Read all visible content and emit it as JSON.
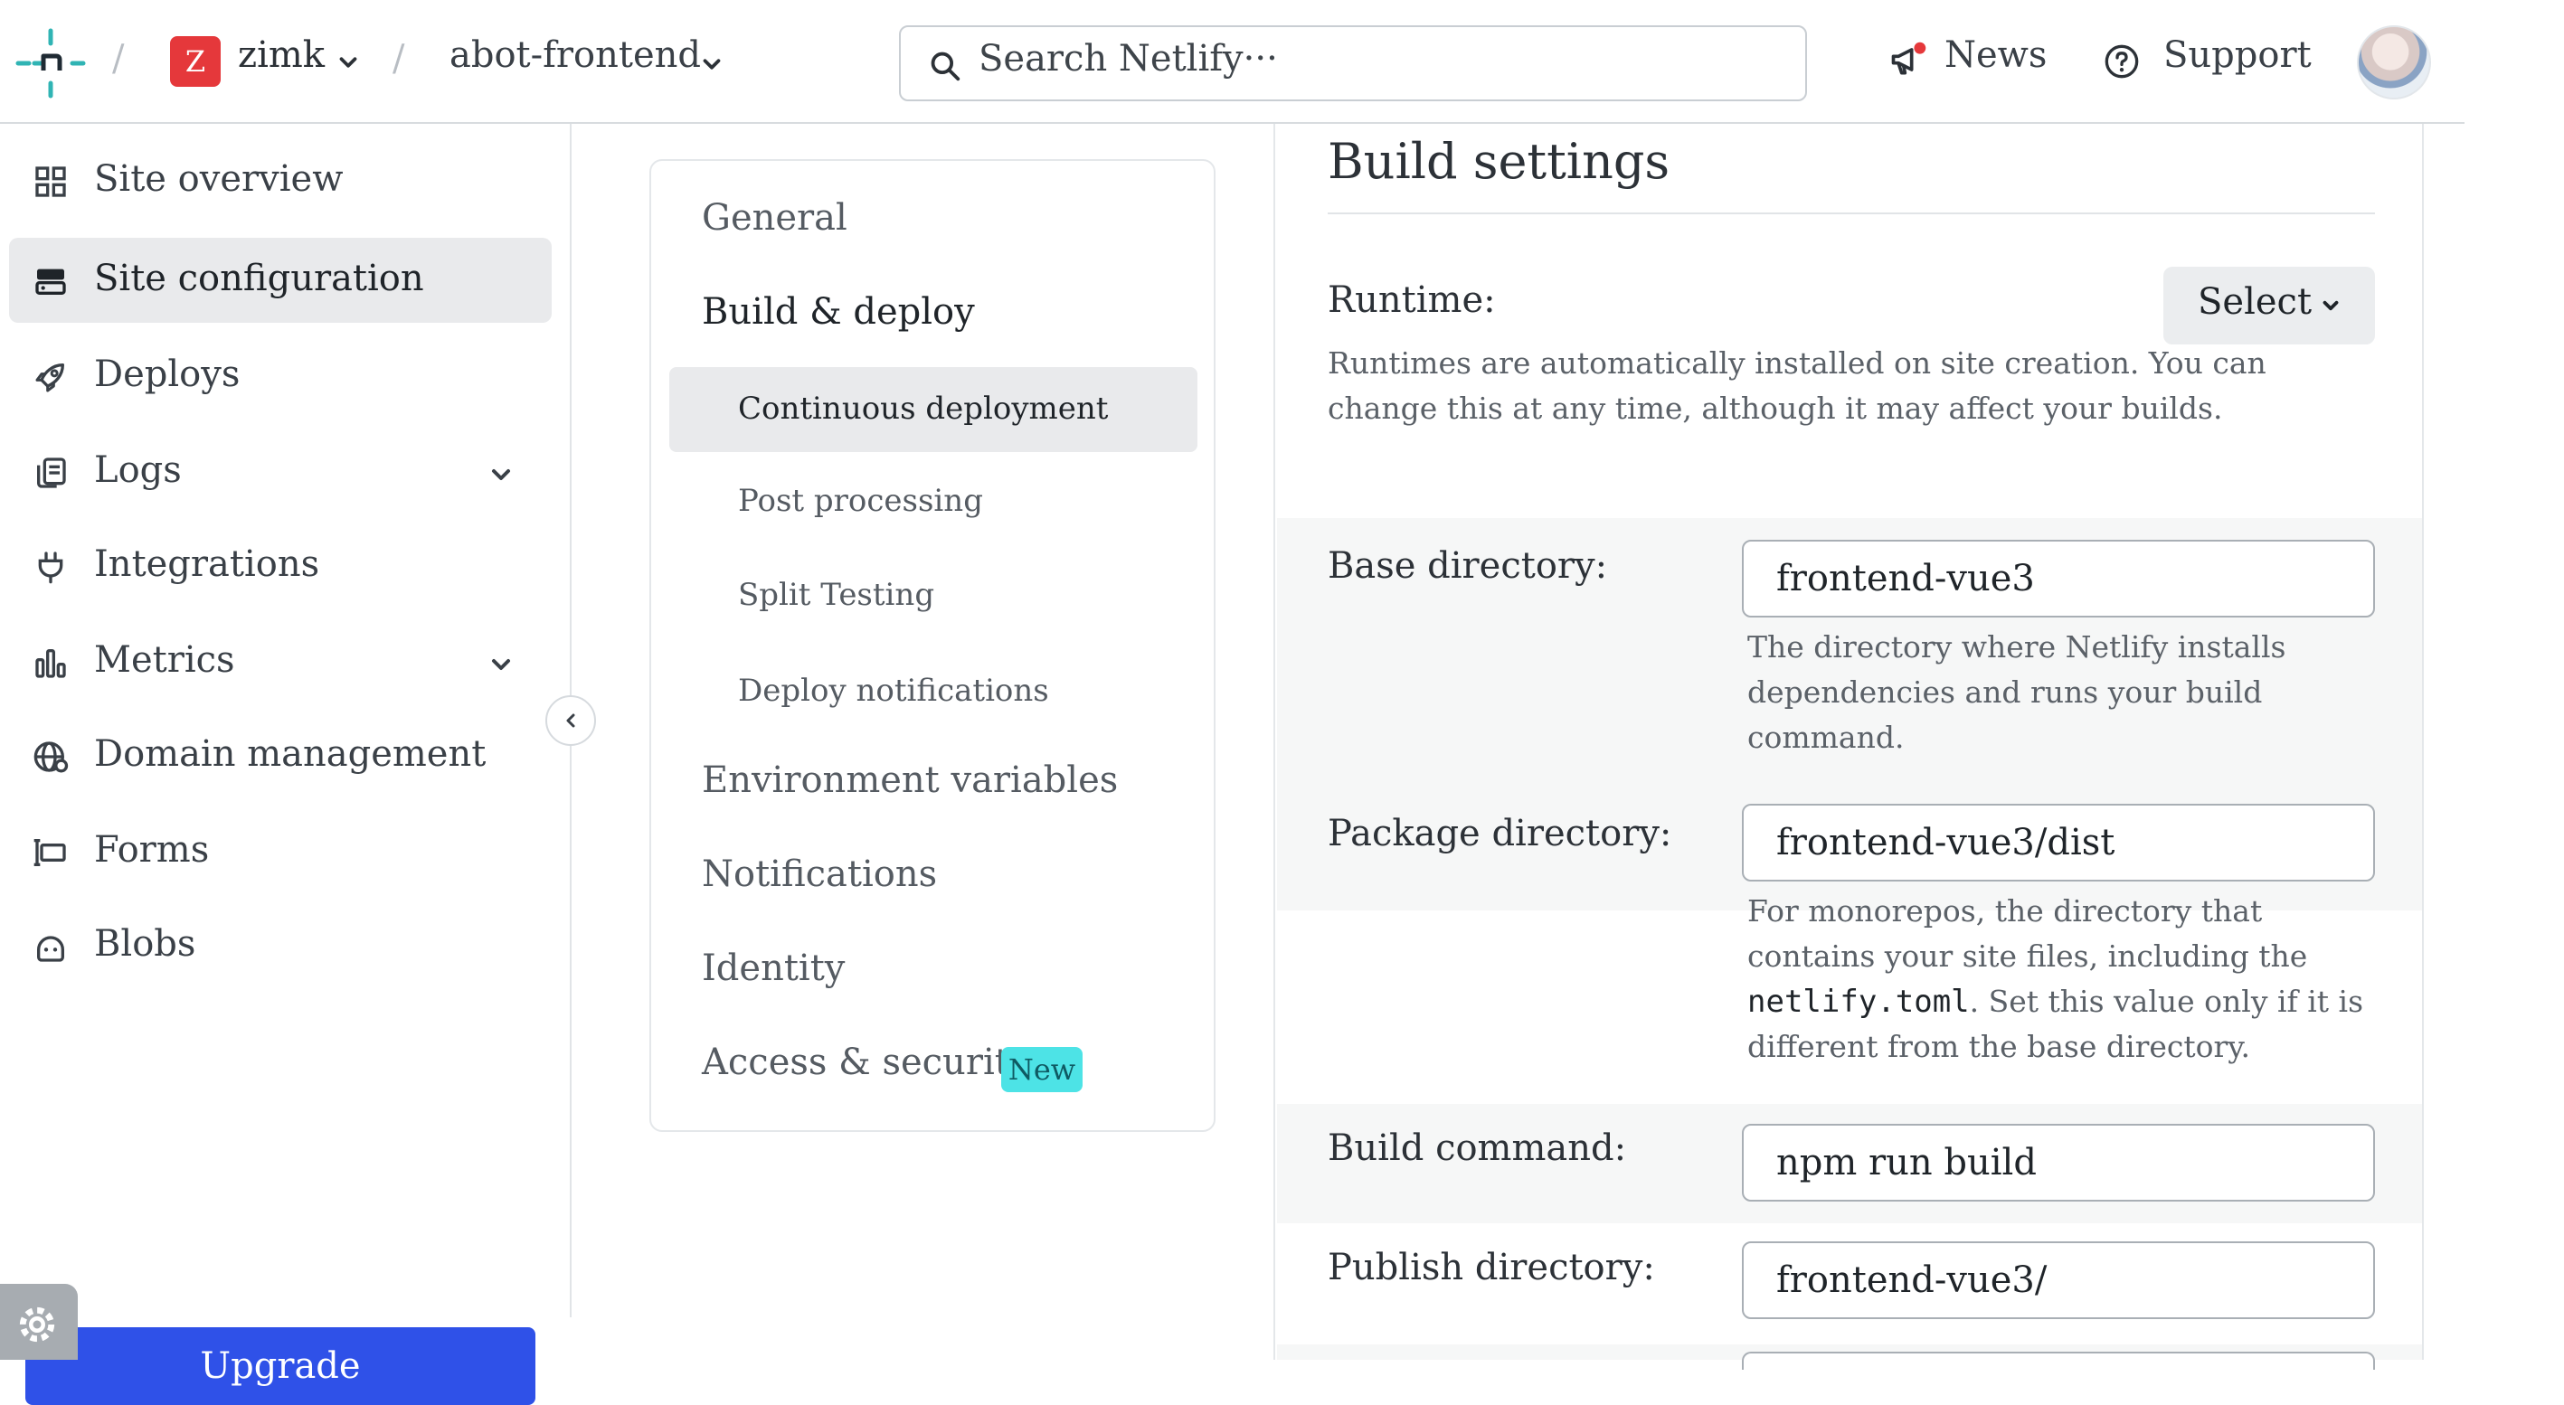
{
  "topbar": {
    "team_initial": "Z",
    "team_name": "zimk",
    "site_name": "abot-frontend",
    "search_placeholder": "Search Netlify···",
    "news_label": "News",
    "support_label": "Support"
  },
  "sidebar": {
    "items": [
      {
        "label": "Site overview",
        "icon": "grid-icon"
      },
      {
        "label": "Site configuration",
        "icon": "server-icon"
      },
      {
        "label": "Deploys",
        "icon": "rocket-icon"
      },
      {
        "label": "Logs",
        "icon": "logs-icon"
      },
      {
        "label": "Integrations",
        "icon": "plug-icon"
      },
      {
        "label": "Metrics",
        "icon": "bar-chart-icon"
      },
      {
        "label": "Domain management",
        "icon": "globe-icon"
      },
      {
        "label": "Forms",
        "icon": "form-icon"
      },
      {
        "label": "Blobs",
        "icon": "blob-icon"
      }
    ],
    "upgrade_label": "Upgrade"
  },
  "subnav": {
    "general": "General",
    "build_deploy": "Build & deploy",
    "children": [
      "Continuous deployment",
      "Post processing",
      "Split Testing",
      "Deploy notifications"
    ],
    "environment_variables": "Environment variables",
    "notifications": "Notifications",
    "identity": "Identity",
    "access_security": "Access & security",
    "new_badge": "New"
  },
  "build_settings": {
    "title": "Build settings",
    "runtime_label": "Runtime:",
    "runtime_select": "Select",
    "runtime_desc": "Runtimes are automatically installed on site creation. You can change this at any time, although it may affect your builds.",
    "base_dir_label": "Base directory:",
    "base_dir_value": "frontend-vue3",
    "base_dir_desc": "The directory where Netlify installs dependencies and runs your build command.",
    "package_dir_label": "Package directory:",
    "package_dir_value": "frontend-vue3/dist",
    "package_dir_desc_1": "For monorepos, the directory that contains your site files, including the ",
    "package_dir_desc_code": "netlify.toml",
    "package_dir_desc_2": ". Set this value only if it is different from the base directory.",
    "build_cmd_label": "Build command:",
    "build_cmd_value": "npm run build",
    "publish_dir_label": "Publish directory:",
    "publish_dir_value": "frontend-vue3/"
  },
  "colors": {
    "accent": "#2f51e8",
    "badge_bg": "#4de3e6",
    "team_avatar": "#e5383b",
    "logo_teal": "#30b4b4"
  }
}
